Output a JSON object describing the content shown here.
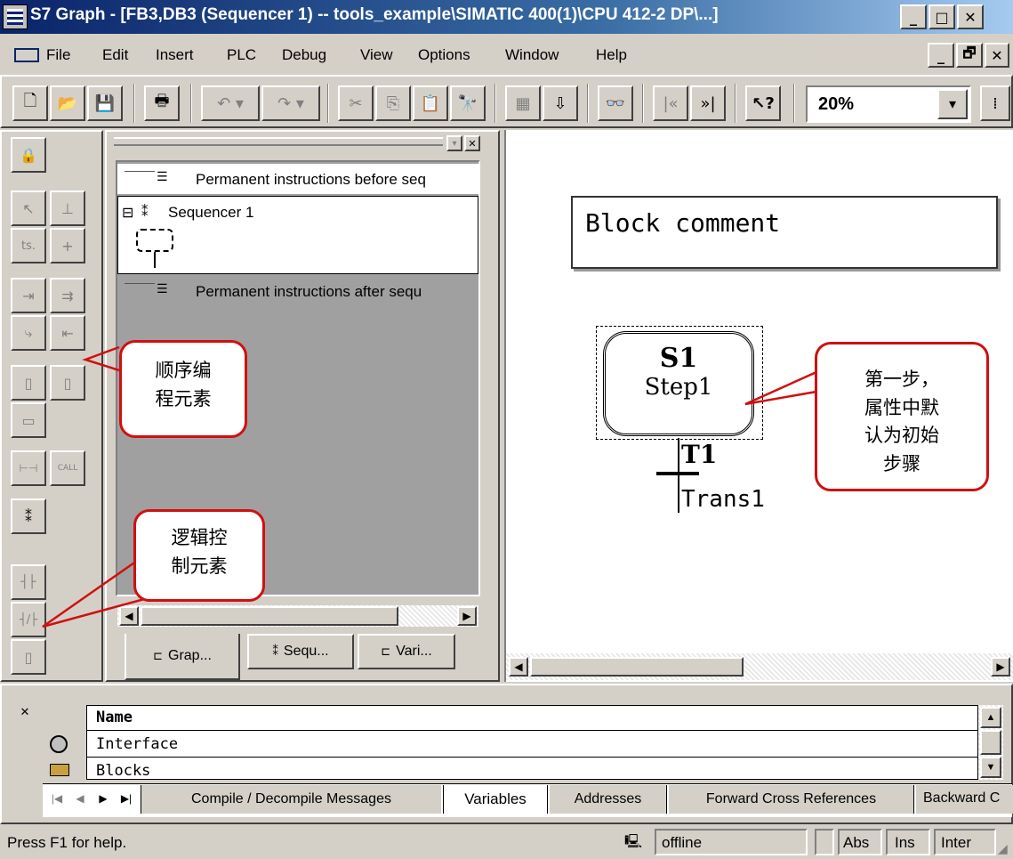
{
  "window": {
    "title": "S7 Graph - [FB3,DB3 (Sequencer 1) -- tools_example\\SIMATIC 400(1)\\CPU 412-2 DP\\...]",
    "min_label": "_",
    "max_label": "□",
    "close_label": "✕",
    "child_restore_label": "🗗"
  },
  "menu": [
    "File",
    "Edit",
    "Insert",
    "PLC",
    "Debug",
    "View",
    "Options",
    "Window",
    "Help"
  ],
  "toolbar": {
    "zoom_value": "20%",
    "dropdown_label": "▾",
    "icons": {
      "new": "🗋",
      "open": "📂",
      "save": "💾",
      "print": "🖶",
      "undo": "↶ ▾",
      "redo": "↷ ▾",
      "cut": "✂",
      "copy": "⎘",
      "paste": "📋",
      "find": "🔭",
      "overview": "▦",
      "download": "⇩",
      "monitor": "👓",
      "first": "|«",
      "last": "»|",
      "help": "↖?"
    }
  },
  "palette": {
    "lock": "🔒",
    "select": "↖",
    "step_trans": "⊥",
    "ts": "ts.",
    "trans": "+",
    "alt_branch": "⇥",
    "sim_branch": "⇉",
    "jump": "⤷",
    "branch_close": "⇤",
    "box1": "▯",
    "box2": "▯",
    "line": "▭",
    "perm": "⊢⊣",
    "call": "CALL",
    "seq": "⁑",
    "nc_contact": "┤├",
    "nc_contact2": "┤/├",
    "coil": "▯"
  },
  "tree": {
    "items": [
      "Permanent instructions before seq",
      "Sequencer 1",
      "Permanent instructions after sequ"
    ],
    "tabs": [
      "Grap...",
      "Sequ...",
      "Vari..."
    ],
    "expand_label": "⊟",
    "close_label": "✕",
    "float_label": "▾"
  },
  "graph": {
    "block_comment": "Block comment",
    "step_number": "S1",
    "step_name": "Step1",
    "transition_number": "T1",
    "transition_name": "Trans1"
  },
  "callouts": {
    "palette_seq": [
      "顺序编",
      "程元素"
    ],
    "palette_logic": [
      "逻辑控",
      "制元素"
    ],
    "step_note": [
      "第一步，",
      "属性中默",
      "认为初始",
      "步骤"
    ]
  },
  "bottom": {
    "column_header": "Name",
    "rows": [
      "Interface",
      "Blocks"
    ],
    "tabs": [
      "Compile / Decompile Messages",
      "Variables",
      "Addresses",
      "Forward Cross References",
      "Backward C"
    ],
    "nav": [
      "|◀",
      "◀",
      "▶",
      "▶|"
    ]
  },
  "status": {
    "help": "Press F1 for help.",
    "connection": "offline",
    "abs": "Abs",
    "ins": "Ins",
    "inter": "Inter"
  }
}
